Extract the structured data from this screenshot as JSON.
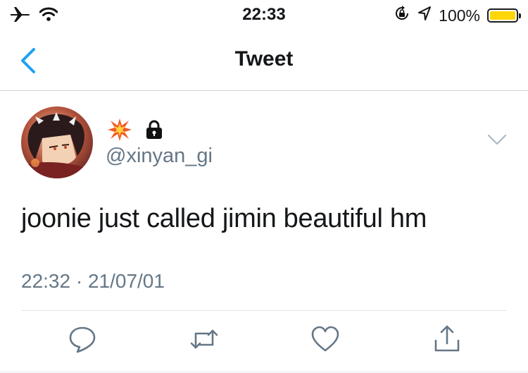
{
  "status_bar": {
    "time": "22:33",
    "battery_text": "100%",
    "battery_level": 1.0,
    "icons": [
      "airplane-icon",
      "wifi-icon",
      "orientation-lock-icon",
      "location-arrow-icon",
      "battery-icon"
    ]
  },
  "nav": {
    "title": "Tweet",
    "back_icon": "chevron-left-icon"
  },
  "tweet": {
    "display_name_emoji": "💥",
    "protected_icon": "lock-icon",
    "handle": "@xinyan_gi",
    "text": "joonie just called jimin beautiful hm",
    "timestamp": "22:32 · 21/07/01",
    "menu_icon": "chevron-down-icon"
  },
  "actions": [
    {
      "icon": "reply-icon"
    },
    {
      "icon": "retweet-icon"
    },
    {
      "icon": "like-icon"
    },
    {
      "icon": "share-icon"
    }
  ],
  "colors": {
    "accent": "#1da1f2",
    "secondary_text": "#657786",
    "action_icon": "#657786",
    "battery": "#ffd60a"
  }
}
